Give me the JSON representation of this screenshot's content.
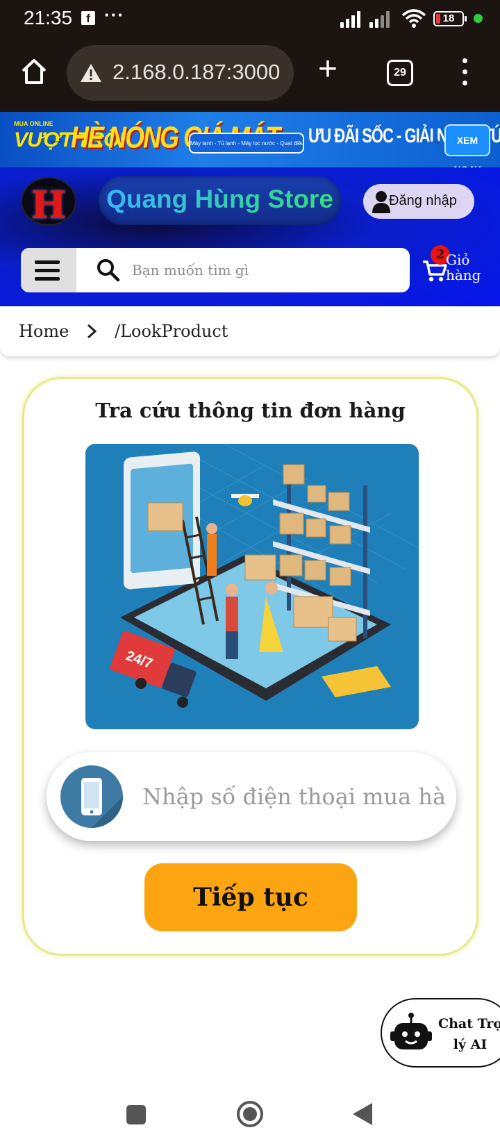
{
  "status_bar": {
    "time": "21:35",
    "notification_dots": "···",
    "battery_level": "18",
    "accent_colors": {
      "battery_low": "#e53935",
      "active_dot": "#2ecc40"
    }
  },
  "browser": {
    "url": "2.168.0.187:3000",
    "tab_count": "29",
    "icons": [
      "home-icon",
      "warning-icon",
      "plus-icon",
      "tabs-icon",
      "more-icon"
    ]
  },
  "banner": {
    "left_small": "MUA ONLINE",
    "left_big": "VƯỢT TRỘI",
    "title": "HÈ NÓNG GIÁ MÁT",
    "products": "Máy lạnh - Tủ lạnh - Máy lọc nước - Quạt điều hòa - Quạt mát",
    "promo": "ƯU ĐÃI SỐC - GIẢI NHIỆT TỨC THÌ",
    "cta": "XEM NGAY"
  },
  "header": {
    "logo_letter": "H",
    "store_name": "Quang Hùng Store",
    "login_label": "Đăng nhập",
    "search_placeholder": "Bạn muốn tìm gì",
    "cart_count": "2",
    "cart_label": "Giỏ hàng"
  },
  "breadcrumb": {
    "home": "Home",
    "current": "/LookProduct"
  },
  "lookup": {
    "title": "Tra cứu thông tin đơn hàng",
    "phone_placeholder": "Nhập số điện thoại mua hàng",
    "phone_value": "",
    "continue_label": "Tiếp tục",
    "illustration_badge": "24/7"
  },
  "chat_widget": {
    "line1": "Chat Trợ",
    "line2": "lý AI"
  },
  "colors": {
    "header_blue": "#0616ee",
    "continue_button": "#fca411",
    "card_border": "#e7e98f",
    "illustration_bg": "#1f7fb8"
  }
}
